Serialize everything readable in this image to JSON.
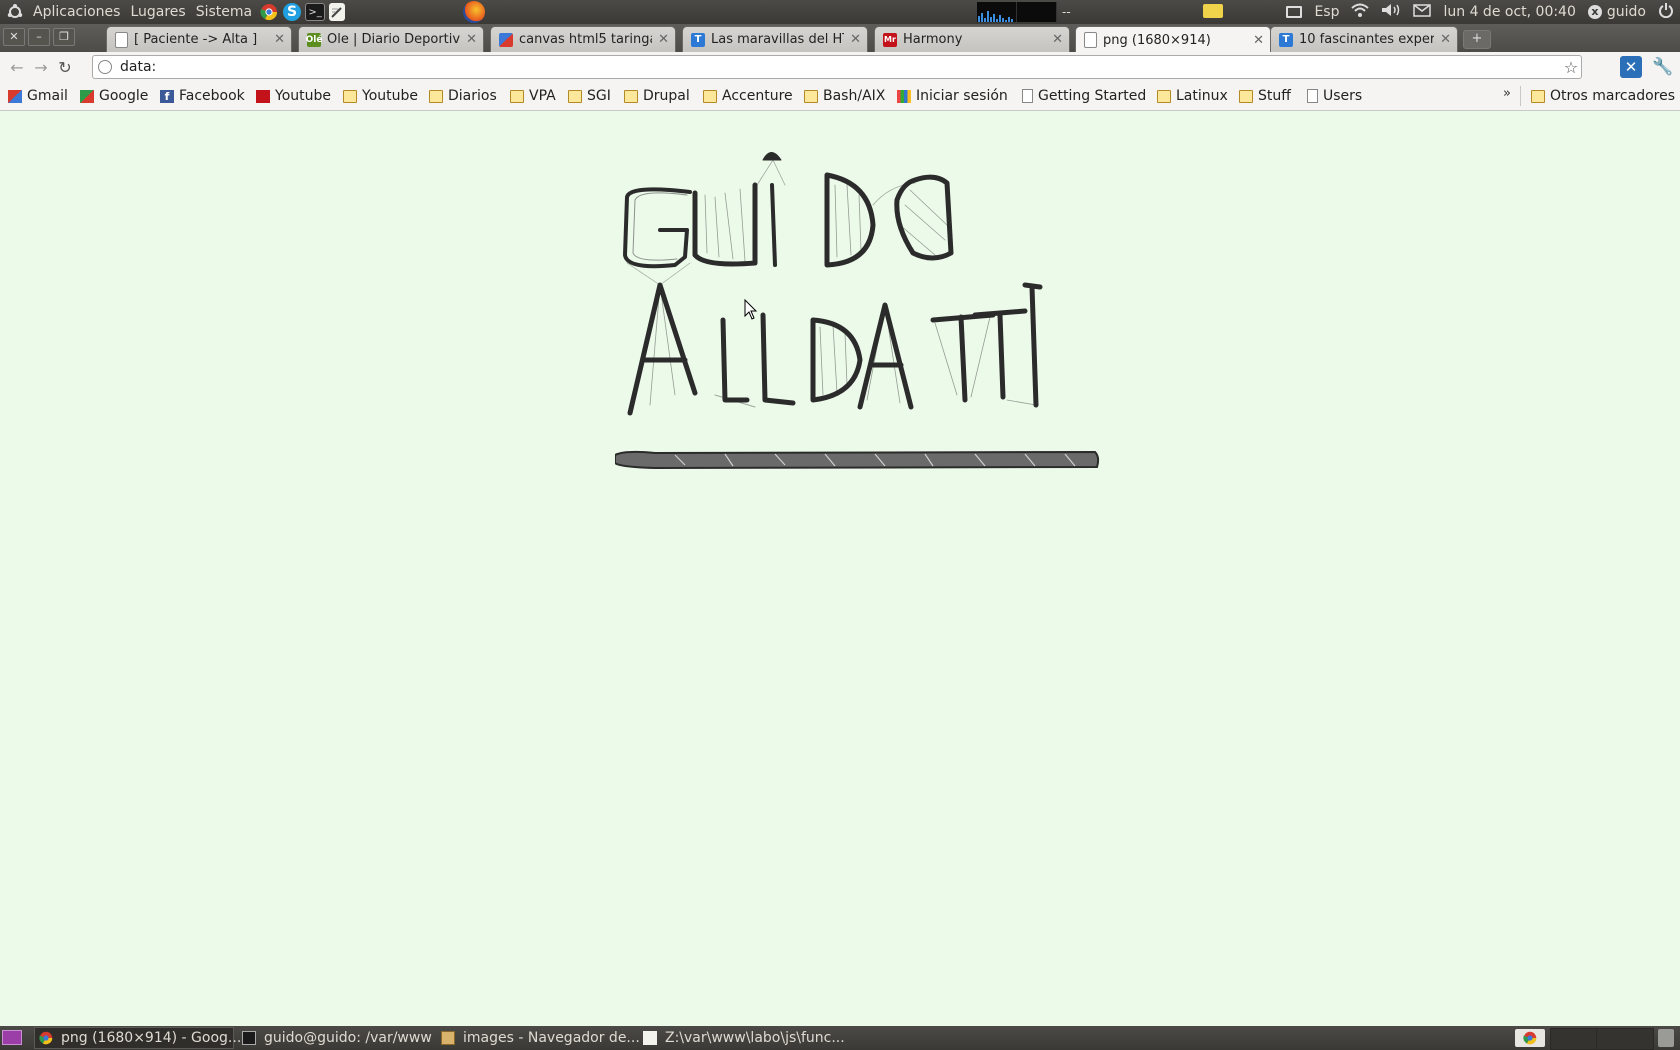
{
  "top_panel": {
    "menus": [
      "Aplicaciones",
      "Lugares",
      "Sistema"
    ],
    "sysmon_sep": "--",
    "keyboard_layout": "Esp",
    "datetime": "lun  4 de oct, 00:40",
    "user": "guido"
  },
  "tabs": [
    {
      "title": "[ Paciente -> Alta ]",
      "icon": "page-icon"
    },
    {
      "title": "Ole | Diario Deportivo",
      "icon": "ole-favicon"
    },
    {
      "title": "canvas html5 taringa...",
      "icon": "google-favicon"
    },
    {
      "title": "Las maravillas del HT...",
      "icon": "taringa-favicon"
    },
    {
      "title": "Harmony",
      "icon": "harmony-favicon"
    },
    {
      "title": "png (1680×914)",
      "icon": "page-icon",
      "active": true
    },
    {
      "title": "10 fascinantes experi...",
      "icon": "taringa-favicon"
    }
  ],
  "toolbar": {
    "url": "data:"
  },
  "bookmarks": {
    "items": [
      "Gmail",
      "Google",
      "Facebook",
      "Youtube",
      "Youtube",
      "Diarios",
      "VPA",
      "SGI",
      "Drupal",
      "Accenture",
      "Bash/AIX",
      "Iniciar sesión",
      "Getting Started",
      "Latinux",
      "Stuff",
      "Users"
    ],
    "overflow": "»",
    "other": "Otros marcadores"
  },
  "content": {
    "drawing_lines": [
      "GUIDO",
      "ALLDATTI"
    ]
  },
  "taskbar": {
    "tasks": [
      "png (1680×914) - Goog...",
      "guido@guido: /var/www",
      "images - Navegador de...",
      "Z:\\var\\www\\labo\\js\\func..."
    ]
  },
  "colors": {
    "page_background": "#ecfaea",
    "panel": "#3f3e3a",
    "ink": "#2b2b2b"
  }
}
